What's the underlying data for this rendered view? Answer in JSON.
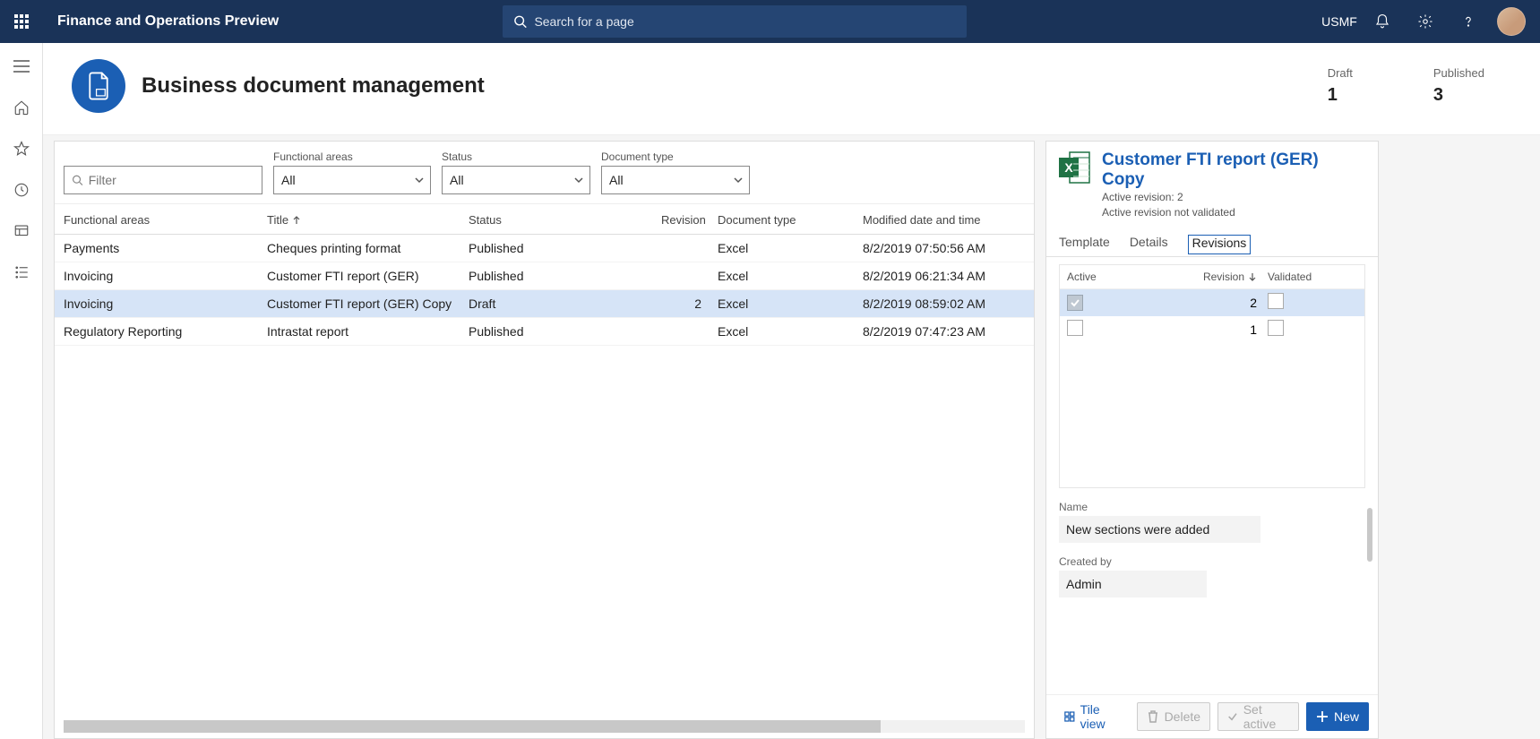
{
  "appTitle": "Finance and Operations Preview",
  "search": {
    "placeholder": "Search for a page"
  },
  "company": "USMF",
  "page": {
    "title": "Business document management",
    "stats": {
      "draftLabel": "Draft",
      "draftValue": "1",
      "publishedLabel": "Published",
      "publishedValue": "3"
    }
  },
  "filters": {
    "filterPlaceholder": "Filter",
    "funcLabel": "Functional areas",
    "funcValue": "All",
    "statusLabel": "Status",
    "statusValue": "All",
    "doctypeLabel": "Document type",
    "doctypeValue": "All"
  },
  "gridHeaders": {
    "func": "Functional areas",
    "title": "Title",
    "status": "Status",
    "revision": "Revision",
    "doctype": "Document type",
    "modified": "Modified date and time"
  },
  "rows": [
    {
      "func": "Payments",
      "title": "Cheques printing format",
      "status": "Published",
      "revision": "",
      "doctype": "Excel",
      "modified": "8/2/2019 07:50:56 AM"
    },
    {
      "func": "Invoicing",
      "title": "Customer FTI report (GER)",
      "status": "Published",
      "revision": "",
      "doctype": "Excel",
      "modified": "8/2/2019 06:21:34 AM"
    },
    {
      "func": "Invoicing",
      "title": "Customer FTI report (GER) Copy",
      "status": "Draft",
      "revision": "2",
      "doctype": "Excel",
      "modified": "8/2/2019 08:59:02 AM"
    },
    {
      "func": "Regulatory Reporting",
      "title": "Intrastat report",
      "status": "Published",
      "revision": "",
      "doctype": "Excel",
      "modified": "8/2/2019 07:47:23 AM"
    }
  ],
  "detail": {
    "title": "Customer FTI report (GER) Copy",
    "sub1": "Active revision: 2",
    "sub2": "Active revision not validated",
    "tabs": {
      "template": "Template",
      "details": "Details",
      "revisions": "Revisions"
    },
    "revHeaders": {
      "active": "Active",
      "revision": "Revision",
      "validated": "Validated"
    },
    "revRows": [
      {
        "active": true,
        "revision": "2"
      },
      {
        "active": false,
        "revision": "1"
      }
    ],
    "nameLabel": "Name",
    "nameValue": "New sections were added",
    "createdLabel": "Created by",
    "createdValue": "Admin"
  },
  "footer": {
    "tileView": "Tile view",
    "delete": "Delete",
    "setActive": "Set active",
    "newBtn": "New"
  }
}
